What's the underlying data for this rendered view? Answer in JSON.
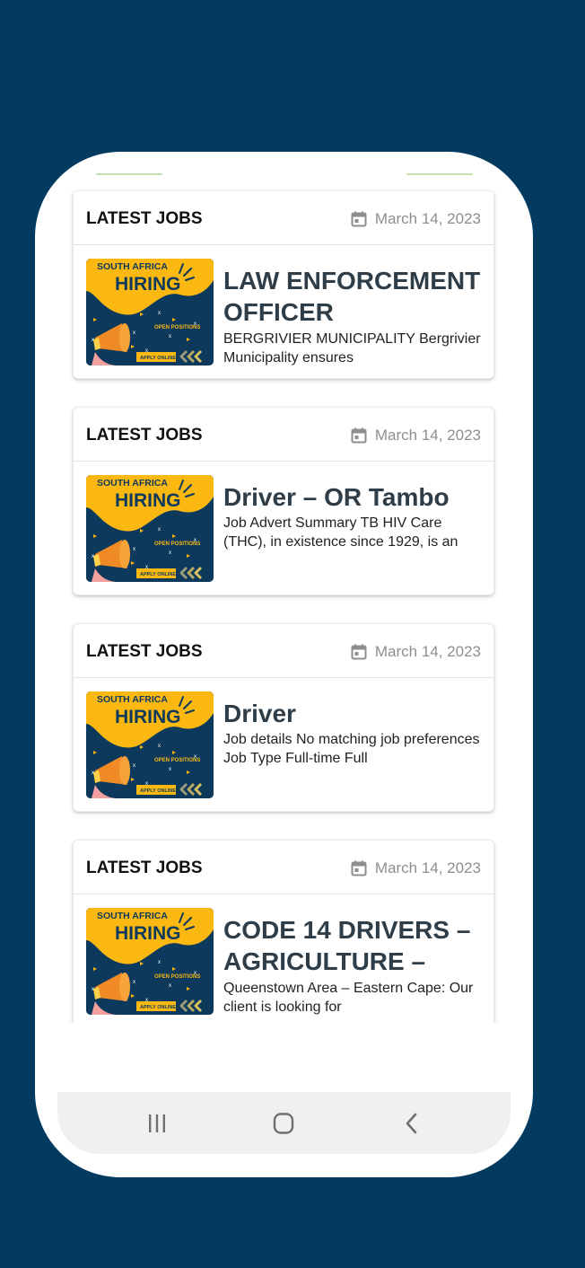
{
  "cards": [
    {
      "category": "LATEST JOBS",
      "date": "March 14, 2023",
      "title": "LAW ENFORCEMENT OFFICER",
      "description": "BERGRIVIER MUNICIPALITY Bergrivier Municipality ensures"
    },
    {
      "category": "LATEST JOBS",
      "date": "March 14, 2023",
      "title": "Driver – OR Tambo",
      "description": "Job Advert Summary TB HIV Care (THC), in existence since 1929, is an"
    },
    {
      "category": "LATEST JOBS",
      "date": "March 14, 2023",
      "title": "Driver",
      "description": "Job details No matching job preferences Job Type Full-time Full"
    },
    {
      "category": "LATEST JOBS",
      "date": "March 14, 2023",
      "title": "CODE 14 DRIVERS – AGRICULTURE –",
      "description": "Queenstown Area – Eastern Cape: Our client is looking for"
    }
  ],
  "thumbnail": {
    "line1": "SOUTH AFRICA",
    "line2": "HIRING",
    "line3": "OPEN POSITIONS",
    "line4": "APPLY ONLINE"
  },
  "colors": {
    "background": "#023b5f",
    "title": "#2e3d47",
    "thumb_yellow": "#fbb811",
    "thumb_navy": "#0d3a5c"
  },
  "navbar": {
    "icons": [
      "recent-apps-icon",
      "home-icon",
      "back-icon"
    ]
  }
}
